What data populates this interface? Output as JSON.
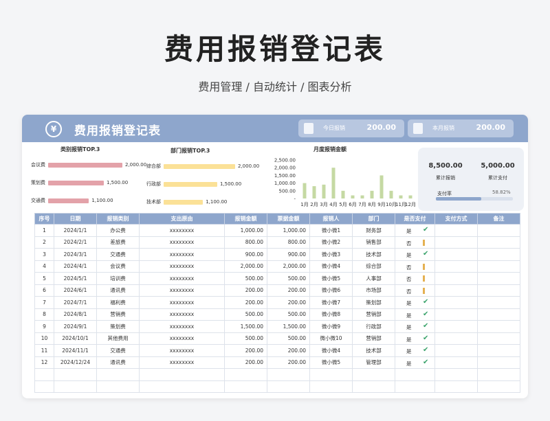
{
  "page": {
    "title": "费用报销登记表",
    "subtitle": "费用管理 / 自动统计 / 图表分析"
  },
  "header": {
    "app_title": "费用报销登记表",
    "logo_symbol": "¥",
    "today": {
      "label": "今日报销",
      "value": "200.00"
    },
    "month": {
      "label": "本月报销",
      "value": "200.00"
    }
  },
  "panels": {
    "category_title": "类别报销TOP.3",
    "dept_title": "部门报销TOP.3",
    "monthly_title": "月度报销金额"
  },
  "category_top3": [
    {
      "name": "会议费",
      "value": 2000,
      "label": "2,000.00"
    },
    {
      "name": "策划费",
      "value": 1500,
      "label": "1,500.00"
    },
    {
      "name": "交通费",
      "value": 1100,
      "label": "1,100.00"
    }
  ],
  "dept_top3": [
    {
      "name": "综合部",
      "value": 2000,
      "label": "2,000.00"
    },
    {
      "name": "行政部",
      "value": 1500,
      "label": "1,500.00"
    },
    {
      "name": "技术部",
      "value": 1100,
      "label": "1,100.00"
    }
  ],
  "chart_data": {
    "type": "bar",
    "title": "月度报销金额",
    "categories": [
      "1月",
      "2月",
      "3月",
      "4月",
      "5月",
      "6月",
      "7月",
      "8月",
      "9月",
      "10月",
      "11月",
      "12月"
    ],
    "values": [
      1000,
      800,
      900,
      2000,
      500,
      200,
      200,
      500,
      1500,
      500,
      200,
      200
    ],
    "ylim": [
      0,
      2500
    ],
    "yticks": [
      "2,500.00",
      "2,000.00",
      "1,500.00",
      "1,000.00",
      "500.00",
      "-"
    ],
    "color": "#c5d9a3"
  },
  "summary": {
    "total_label": "累计报销",
    "total_value": "8,500.00",
    "paid_label": "累计支付",
    "paid_value": "5,000.00",
    "rate_label": "支付率",
    "rate_text": "58.82%",
    "rate": 0.5882
  },
  "table": {
    "headers": [
      "序号",
      "日期",
      "报销类别",
      "支出原由",
      "报销金额",
      "票据金额",
      "报销人",
      "部门",
      "是否支付",
      "支付方式",
      "备注"
    ],
    "rows": [
      {
        "no": "1",
        "date": "2024/1/1",
        "cat": "办公费",
        "reason": "xxxxxxxx",
        "amount": "1,000.00",
        "receipt": "1,000.00",
        "person": "微小微1",
        "dept": "财务部",
        "paid": "是"
      },
      {
        "no": "2",
        "date": "2024/2/1",
        "cat": "差旅费",
        "reason": "xxxxxxxx",
        "amount": "800.00",
        "receipt": "800.00",
        "person": "微小微2",
        "dept": "销售部",
        "paid": "否"
      },
      {
        "no": "3",
        "date": "2024/3/1",
        "cat": "交通费",
        "reason": "xxxxxxxx",
        "amount": "900.00",
        "receipt": "900.00",
        "person": "微小微3",
        "dept": "技术部",
        "paid": "是"
      },
      {
        "no": "4",
        "date": "2024/4/1",
        "cat": "会议费",
        "reason": "xxxxxxxx",
        "amount": "2,000.00",
        "receipt": "2,000.00",
        "person": "微小微4",
        "dept": "综合部",
        "paid": "否"
      },
      {
        "no": "5",
        "date": "2024/5/1",
        "cat": "培训费",
        "reason": "xxxxxxxx",
        "amount": "500.00",
        "receipt": "500.00",
        "person": "微小微5",
        "dept": "人事部",
        "paid": "否"
      },
      {
        "no": "6",
        "date": "2024/6/1",
        "cat": "通讯费",
        "reason": "xxxxxxxx",
        "amount": "200.00",
        "receipt": "200.00",
        "person": "微小微6",
        "dept": "市场部",
        "paid": "否"
      },
      {
        "no": "7",
        "date": "2024/7/1",
        "cat": "福利费",
        "reason": "xxxxxxxx",
        "amount": "200.00",
        "receipt": "200.00",
        "person": "微小微7",
        "dept": "策划部",
        "paid": "是"
      },
      {
        "no": "8",
        "date": "2024/8/1",
        "cat": "营销费",
        "reason": "xxxxxxxx",
        "amount": "500.00",
        "receipt": "500.00",
        "person": "微小微8",
        "dept": "营销部",
        "paid": "是"
      },
      {
        "no": "9",
        "date": "2024/9/1",
        "cat": "策划费",
        "reason": "xxxxxxxx",
        "amount": "1,500.00",
        "receipt": "1,500.00",
        "person": "微小微9",
        "dept": "行政部",
        "paid": "是"
      },
      {
        "no": "10",
        "date": "2024/10/1",
        "cat": "其他费用",
        "reason": "xxxxxxxx",
        "amount": "500.00",
        "receipt": "500.00",
        "person": "微小微10",
        "dept": "营销部",
        "paid": "是"
      },
      {
        "no": "11",
        "date": "2024/11/1",
        "cat": "交通费",
        "reason": "xxxxxxxx",
        "amount": "200.00",
        "receipt": "200.00",
        "person": "微小微4",
        "dept": "技术部",
        "paid": "是"
      },
      {
        "no": "12",
        "date": "2024/12/24",
        "cat": "通讯费",
        "reason": "xxxxxxxx",
        "amount": "200.00",
        "receipt": "200.00",
        "person": "微小微5",
        "dept": "管理部",
        "paid": "是"
      }
    ],
    "empty_rows": 2
  }
}
